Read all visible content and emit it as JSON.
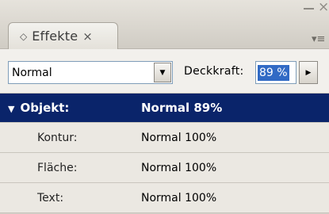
{
  "panel": {
    "tab_label": "Effekte",
    "tab_close": "×",
    "window_close": "×",
    "menu_icon": "≡"
  },
  "controls": {
    "blend_mode": "Normal",
    "opacity_label": "Deckkraft:",
    "opacity_value": "89 %"
  },
  "rows": [
    {
      "name": "Objekt:",
      "value": "Normal 89%",
      "selected": true,
      "expanded": true
    },
    {
      "name": "Kontur:",
      "value": "Normal 100%"
    },
    {
      "name": "Fläche:",
      "value": "Normal 100%"
    },
    {
      "name": "Text:",
      "value": "Normal 100%"
    }
  ],
  "colors": {
    "selection": "#0a246a",
    "panel_bg": "#ebe8e2"
  }
}
